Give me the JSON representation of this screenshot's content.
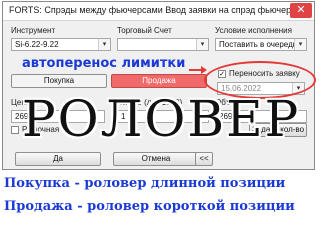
{
  "window": {
    "title": "FORTS: Спрэды между фьючерсами Ввод заявки на спрэд фьючерсов",
    "close_glyph": "✕"
  },
  "form": {
    "instrument_label": "Инструмент",
    "instrument_value": "Si-6.22-9.22",
    "account_label": "Торговый Счет",
    "account_value": "",
    "exec_label": "Условие исполнения",
    "exec_value": "Поставить в очередь",
    "buy_label": "Покупка",
    "sell_label": "Продажа",
    "transfer_label": "Переносить заявку",
    "transfer_date": "15.06.2022",
    "price_label": "Цена",
    "price_value": "269",
    "qty_label": "Кол-во (лот 1000)",
    "qty_value": "1",
    "volume_label": "Объем",
    "volume_value": "269000",
    "market_label": "Рыночная",
    "set_button": "Задать кол-во",
    "ok_button": "Да",
    "cancel_button": "Отмена",
    "back_button": "<<",
    "dropdown_glyph": "▾"
  },
  "overlay": {
    "autotransfer_text": "автоперенос лимитки",
    "big_text": "РОЛОВЕР",
    "caption_buy": "Покупка - роловер длинной позиции",
    "caption_sell": "Продажа - роловер короткой позиции"
  },
  "colors": {
    "sell_button": "#f06a6a",
    "overlay_text": "#1a3ad6",
    "highlight": "#e53935"
  }
}
